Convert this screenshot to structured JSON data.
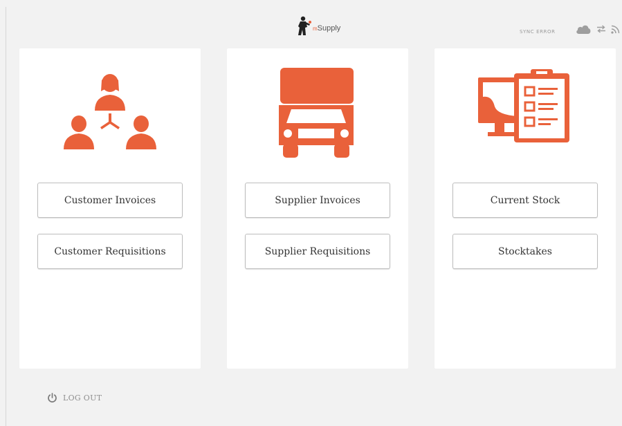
{
  "header": {
    "logo_prefix": "m",
    "logo_text": "Supply",
    "sync_status": "SYNC ERROR",
    "icons": [
      "cloud-icon",
      "sync-arrows-icon",
      "rss-icon"
    ]
  },
  "cards": [
    {
      "icon": "customers-network-icon",
      "buttons": [
        "Customer Invoices",
        "Customer Requisitions"
      ]
    },
    {
      "icon": "truck-icon",
      "buttons": [
        "Supplier Invoices",
        "Supplier Requisitions"
      ]
    },
    {
      "icon": "stock-clipboard-icon",
      "buttons": [
        "Current Stock",
        "Stocktakes"
      ]
    }
  ],
  "footer": {
    "logout_label": "LOG OUT",
    "logout_icon": "power-icon"
  },
  "colors": {
    "accent": "#e9613a",
    "background": "#f2f2f2",
    "card": "#ffffff",
    "muted_text": "#9a9a9a"
  }
}
